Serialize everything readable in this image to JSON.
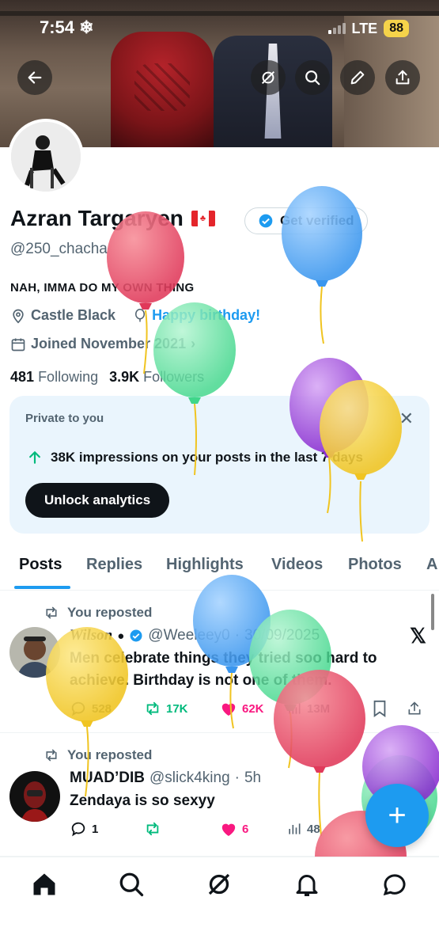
{
  "status_bar": {
    "time": "7:54",
    "carrier": "LTE",
    "battery": "88"
  },
  "profile": {
    "name": "Azran Targaryen",
    "handle": "@250_chacha",
    "get_verified": "Get verified",
    "bio": "NAH, IMMA DO MY OWN THING",
    "location": "Castle Black",
    "birthday": "Happy birthday!",
    "joined": "Joined November 2021",
    "following_count": "481",
    "following_label": "Following",
    "followers_count": "3.9K",
    "followers_label": "Followers"
  },
  "private_card": {
    "title": "Private to you",
    "impressions_text": "38K impressions on your posts in the last 7 days",
    "button": "Unlock analytics"
  },
  "tabs": [
    "Posts",
    "Replies",
    "Highlights",
    "Videos",
    "Photos",
    "A"
  ],
  "posts": [
    {
      "repost_label": "You reposted",
      "display_name": "Wilson",
      "username": "@Weeleey0",
      "date": "30/09/2025",
      "text": "Men celebrate things they tried soo hard to achieve. Birthday is not one of them.",
      "replies": "528",
      "reposts": "17K",
      "likes": "62K",
      "views": "13M"
    },
    {
      "repost_label": "You reposted",
      "display_name": "MUAD’DIB",
      "username": "@slick4king",
      "time": "5h",
      "text": "Zendaya is so sexyy",
      "replies": "1",
      "reposts": "",
      "likes": "6",
      "views": "48"
    }
  ],
  "colors": {
    "accent": "#1d9bf0",
    "like": "#f91880",
    "repost": "#00ba7c",
    "card_bg": "#eaf5fd"
  },
  "icons": [
    "back-arrow-icon",
    "grok-icon",
    "search-icon",
    "edit-icon",
    "share-icon",
    "home-icon",
    "explore-icon",
    "grok-icon",
    "bell-icon",
    "messages-icon"
  ]
}
